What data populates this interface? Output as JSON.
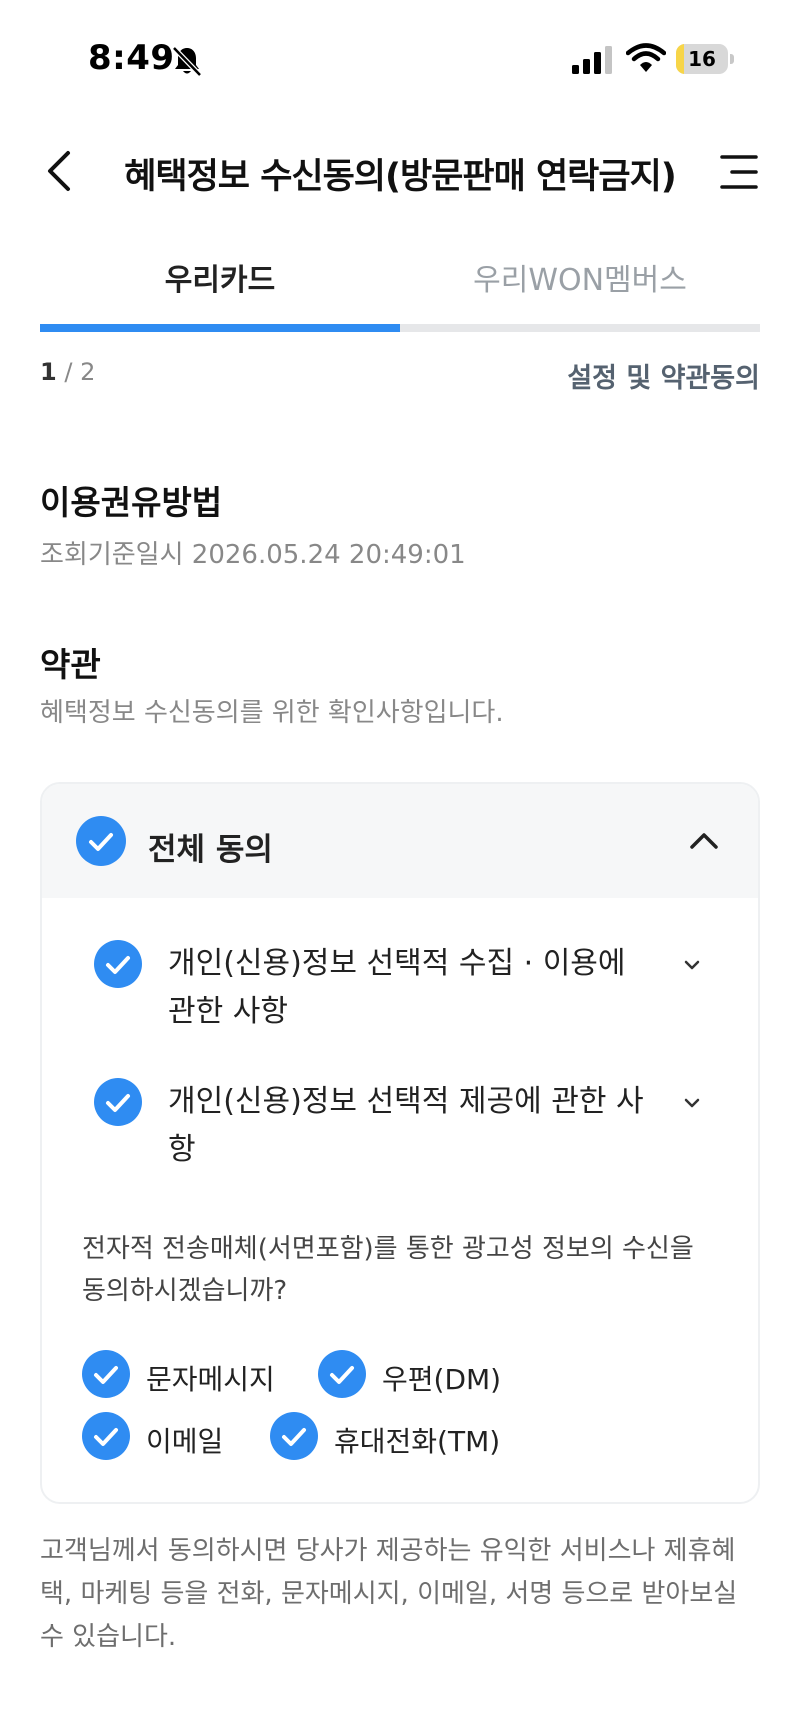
{
  "status_bar": {
    "time": "8:49",
    "battery": "16",
    "battery_level": 0.16,
    "icons": [
      "bell-slash-icon",
      "signal-icon",
      "wifi-icon",
      "battery-icon"
    ]
  },
  "header": {
    "title": "혜택정보 수신동의(방문판매 연락금지)",
    "back_icon": "chevron-left-icon",
    "menu_icon": "menu-icon"
  },
  "tabs": [
    {
      "label": "우리카드",
      "active": true
    },
    {
      "label": "우리WON멤버스",
      "active": false
    }
  ],
  "progress": {
    "current": "1",
    "separator": "/",
    "total": "2",
    "fraction": 0.5
  },
  "settings_link": "설정 및 약관동의",
  "method": {
    "title": "이용권유방법",
    "timestamp": "조회기준일시 2026.05.24 20:49:01"
  },
  "terms": {
    "title": "약관",
    "description": "혜택정보 수신동의를 위한 확인사항입니다."
  },
  "agreement": {
    "all_label": "전체 동의",
    "all_checked": true,
    "items": [
      {
        "label": "개인(신용)정보 선택적 수집 · 이용에 관한 사항",
        "checked": true
      },
      {
        "label": "개인(신용)정보 선택적 제공에 관한 사항",
        "checked": true
      }
    ],
    "question": "전자적 전송매체(서면포함)를 통한 광고성 정보의 수신을 동의하시겠습니까?",
    "channels": [
      {
        "label": "문자메시지",
        "checked": true
      },
      {
        "label": "우편(DM)",
        "checked": true
      },
      {
        "label": "이메일",
        "checked": true
      },
      {
        "label": "휴대전화(TM)",
        "checked": true
      }
    ]
  },
  "footer": "고객님께서 동의하시면 당사가 제공하는 유익한 서비스나 제휴혜택, 마케팅 등을 전화, 문자메시지, 이메일, 서명 등으로 받아보실 수 있습니다.",
  "colors": {
    "accent": "#2f8cf2",
    "check_mark": "#ffffff",
    "link": "#556270",
    "muted_text": "#888888"
  }
}
